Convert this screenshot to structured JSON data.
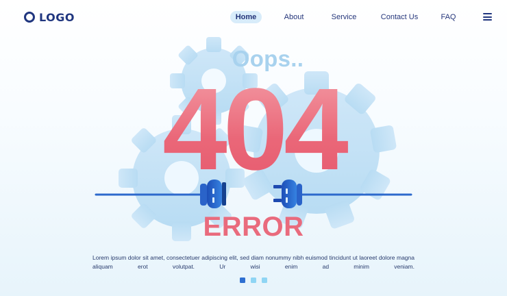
{
  "header": {
    "logo_text": "LOGO",
    "nav": [
      {
        "label": "Home",
        "active": true
      },
      {
        "label": "About",
        "active": false
      },
      {
        "label": "Service",
        "active": false
      },
      {
        "label": "Contact Us",
        "active": false
      },
      {
        "label": "FAQ",
        "active": false
      }
    ],
    "menu_icon": "hamburger-menu-icon"
  },
  "hero": {
    "oops": "Oops..",
    "code": "404",
    "error": "ERROR",
    "description": "Lorem ipsum dolor sit amet, consectetuer adipiscing elit, sed diam nonummy nibh euismod tincidunt ut laoreet dolore magna aliquam erot volutpat. Ur wisi enim ad minim veniam."
  },
  "pagination": {
    "dots": [
      {
        "label": "slide 1",
        "active": true
      },
      {
        "label": "slide 2",
        "active": false
      },
      {
        "label": "slide 3",
        "active": false
      }
    ]
  },
  "colors": {
    "navy": "#20367f",
    "accent_blue": "#2e6fd1",
    "light_blue": "#a8d2ee",
    "pink": "#ea6a78",
    "active_nav_bg": "#d8ecfa"
  },
  "icons": [
    "gear-icon",
    "plug-icon",
    "socket-icon",
    "hamburger-menu-icon"
  ]
}
